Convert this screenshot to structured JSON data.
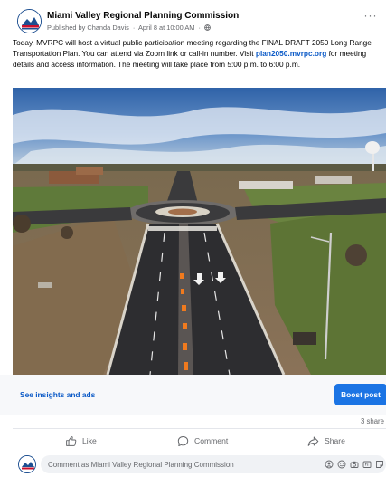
{
  "post": {
    "page_name": "Miami Valley Regional Planning Commission",
    "published_by": "Published by Chanda Davis",
    "date": "April 8 at 10:00 AM",
    "text_before_link": "Today, MVRPC will host a virtual public participation meeting regarding the FINAL DRAFT 2050 Long Range Transportation Plan. You can attend via Zoom link or call-in number. Visit",
    "link_text": "plan2050.mvrpc.org",
    "text_after_link": "for meeting details and access information. The meeting will take place from 5:00 p.m. to 6:00 p.m."
  },
  "insights": {
    "link_label": "See insights and ads",
    "boost_label": "Boost post"
  },
  "stats": {
    "shares": "3 share"
  },
  "actions": {
    "like": "Like",
    "comment": "Comment",
    "share": "Share"
  },
  "comment_box": {
    "placeholder": "Comment as Miami Valley Regional Planning Commission"
  },
  "colors": {
    "accent": "#1b74e4",
    "link": "#0b5ac7",
    "muted": "#65676b"
  }
}
